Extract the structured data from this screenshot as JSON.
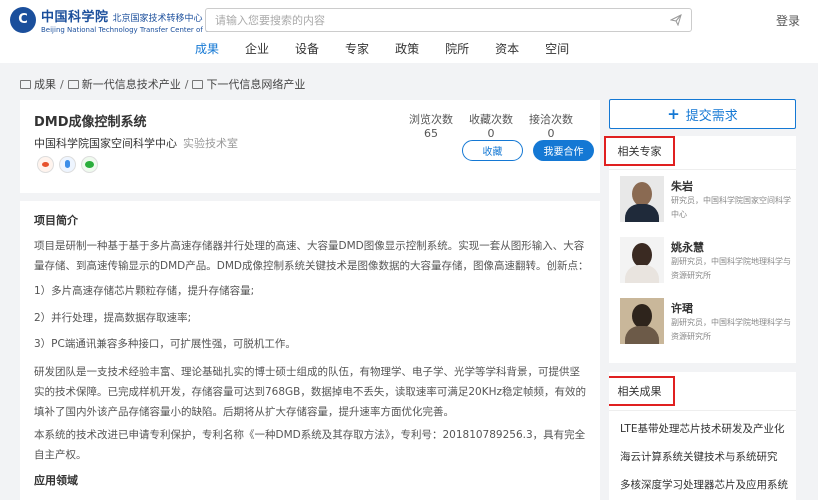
{
  "header": {
    "logo_cn": "中国科学院",
    "logo_sub": "北京国家技术转移中心",
    "logo_en": "Beijing National Technology Transfer Center of CAS",
    "search_placeholder": "请输入您要搜索的内容",
    "login": "登录"
  },
  "nav": [
    "成果",
    "企业",
    "设备",
    "专家",
    "政策",
    "院所",
    "资本",
    "空间"
  ],
  "breadcrumb": [
    "成果",
    "新一代信息技术产业",
    "下一代信息网络产业"
  ],
  "project": {
    "title": "DMD成像控制系统",
    "org": "中国科学院国家空间科学中心",
    "lab": "实验技术室",
    "stats": [
      {
        "label": "浏览次数",
        "value": "65"
      },
      {
        "label": "收藏次数",
        "value": "0"
      },
      {
        "label": "接洽次数",
        "value": "0"
      }
    ],
    "fav_button": "收藏",
    "coop_button": "我要合作"
  },
  "intro": {
    "title": "项目简介",
    "paragraphs": [
      "项目是研制一种基于基于多片高速存储器并行处理的高速、大容量DMD图像显示控制系统。实现一套从图形输入、大容量存储、到高速传输显示的DMD产品。DMD成像控制系统关键技术是图像数据的大容量存储，图像高速翻转。创新点：",
      "1）多片高速存储芯片颗粒存储，提升存储容量;",
      "2）并行处理，提高数据存取速率;",
      " 3）PC端通讯兼容多种接口，可扩展性强，可脱机工作。",
      "研发团队是一支技术经验丰富、理论基础扎实的博士硕士组成的队伍，有物理学、电子学、光学等学科背景，可提供坚实的技术保障。已完成样机开发，存储容量可达到768GB，数据掉电不丢失，读取速率可满足20KHz稳定帧频，有效的填补了国内外该产品存储容量小的缺陷。后期将从扩大存储容量，提升速率方面优化完善。",
      "本系统的技术改进已申请专利保护，专利名称《一种DMD系统及其存取方法》，专利号：201810789256.3，具有完全自主产权。"
    ],
    "application_title": "应用领域"
  },
  "sidebar": {
    "submit_label": "提交需求",
    "experts_title": "相关专家",
    "experts": [
      {
        "name": "朱岩",
        "desc": "研究员，中国科学院国家空间科学中心"
      },
      {
        "name": "姚永慧",
        "desc": "副研究员，中国科学院地理科学与资源研究所"
      },
      {
        "name": "许珺",
        "desc": "副研究员，中国科学院地理科学与资源研究所"
      }
    ],
    "results_title": "相关成果",
    "results": [
      "LTE基带处理芯片技术研发及产业化",
      "海云计算系统关键技术与系统研究",
      "多核深度学习处理器芯片及应用系统"
    ]
  },
  "colors": {
    "primary": "#1478d4",
    "highlight_box": "#e02020",
    "logo": "#1b4f9c"
  }
}
